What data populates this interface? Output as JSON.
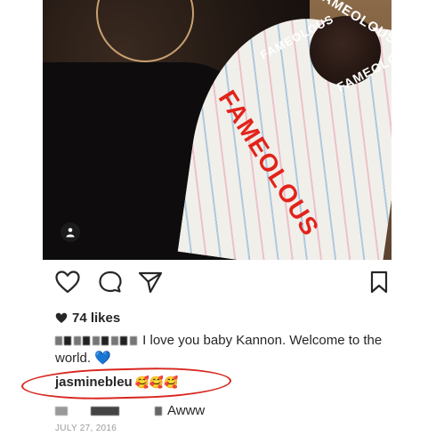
{
  "post": {
    "watermark": "FAMEOLOUS",
    "likes": "74 likes",
    "caption": "I love you baby Kannon. Welcome to the world.",
    "caption_emoji": "💙",
    "comments": [
      {
        "username": "jasminebleu",
        "text": "🥰🥰🥰"
      },
      {
        "text": "Awww"
      }
    ],
    "date": "JULY 27, 2016"
  },
  "icons": [
    "person-tag-icon",
    "heart-icon",
    "comment-icon",
    "share-icon",
    "bookmark-icon"
  ],
  "colors": {
    "highlight": "#d8261f",
    "watermark": "#e2231a"
  }
}
